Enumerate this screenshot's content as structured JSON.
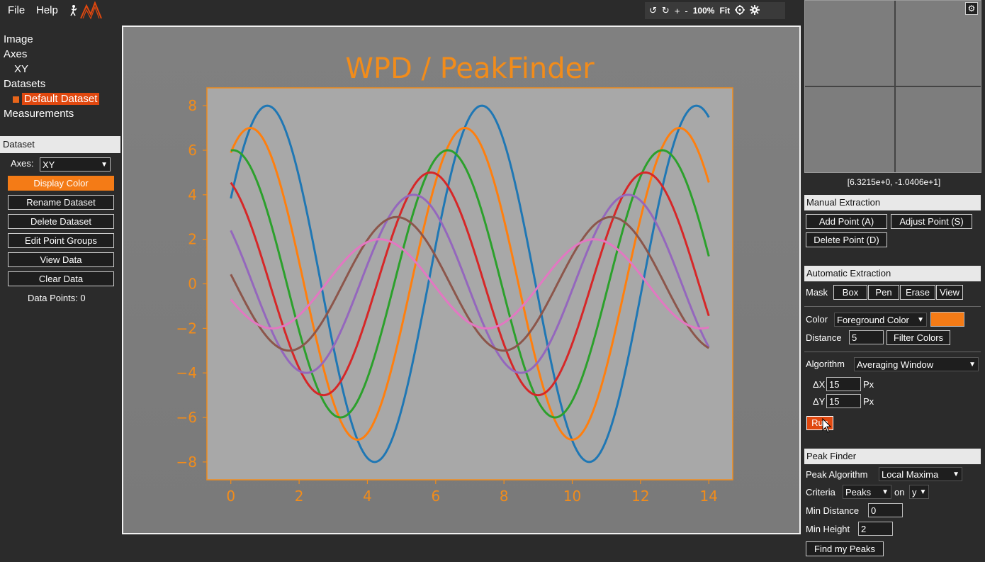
{
  "menu": {
    "file": "File",
    "help": "Help"
  },
  "toolbar": {
    "rotate_ccw": "↺",
    "rotate_cw": "↻",
    "zoom_in": "+",
    "zoom_out": "-",
    "zoom_level": "100%",
    "fit": "Fit"
  },
  "tree": {
    "image": "Image",
    "axes": "Axes",
    "axes_child": "XY",
    "datasets": "Datasets",
    "dataset_child": "Default Dataset",
    "measurements": "Measurements"
  },
  "dataset_panel": {
    "header": "Dataset",
    "axes_label": "Axes:",
    "axes_value": "XY",
    "buttons": [
      "Display Color",
      "Rename Dataset",
      "Delete Dataset",
      "Edit Point Groups",
      "View Data",
      "Clear Data"
    ],
    "data_points": "Data Points: 0"
  },
  "coordinates": "[6.3215e+0, -1.0406e+1]",
  "manual": {
    "header": "Manual Extraction",
    "add_point": "Add Point (A)",
    "adjust_point": "Adjust Point (S)",
    "delete_point": "Delete Point (D)"
  },
  "automatic": {
    "header": "Automatic Extraction",
    "mask_label": "Mask",
    "mask_buttons": [
      "Box",
      "Pen",
      "Erase",
      "View"
    ],
    "color_label": "Color",
    "color_mode": "Foreground Color",
    "color_value": "#f47b16",
    "distance_label": "Distance",
    "distance_value": "5",
    "filter_colors": "Filter Colors",
    "algorithm_label": "Algorithm",
    "algorithm_value": "Averaging Window",
    "dx_label": "ΔX",
    "dx_value": "15",
    "dy_label": "ΔY",
    "dy_value": "15",
    "px_unit": "Px",
    "run": "Run"
  },
  "peak_finder": {
    "header": "Peak Finder",
    "algorithm_label": "Peak Algorithm",
    "algorithm_value": "Local Maxima",
    "criteria_label": "Criteria",
    "criteria_value": "Peaks",
    "on_label": "on",
    "on_value": "y",
    "min_distance_label": "Min Distance",
    "min_distance_value": "0",
    "min_height_label": "Min Height",
    "min_height_value": "2",
    "find_button": "Find my Peaks"
  },
  "chart_data": {
    "type": "line",
    "title": "WPD / PeakFinder",
    "xlabel": "",
    "ylabel": "",
    "xlim": [
      -0.7,
      14.7
    ],
    "ylim": [
      -8.8,
      8.8
    ],
    "xticks": [
      0,
      2,
      4,
      6,
      8,
      10,
      12,
      14
    ],
    "yticks": [
      -8,
      -6,
      -4,
      -2,
      0,
      2,
      4,
      6,
      8
    ],
    "ytick_labels": [
      "−8",
      "−6",
      "−4",
      "−2",
      "0",
      "2",
      "4",
      "6",
      "8"
    ],
    "grid": false,
    "series": [
      {
        "amplitude": 8,
        "phase": 0.5,
        "color": "#1f77b4"
      },
      {
        "amplitude": 7,
        "phase": 1.0,
        "color": "#ff7f0e"
      },
      {
        "amplitude": 6,
        "phase": 1.5,
        "color": "#2ca02c"
      },
      {
        "amplitude": 5,
        "phase": 2.0,
        "color": "#d62728"
      },
      {
        "amplitude": 4,
        "phase": 2.5,
        "color": "#9467bd"
      },
      {
        "amplitude": 3,
        "phase": 3.0,
        "color": "#8c564b"
      },
      {
        "amplitude": 2,
        "phase": 3.5,
        "color": "#e377c2"
      }
    ],
    "x_start": 0,
    "x_end": 14,
    "formula": "y = amplitude * sin(x + phase)"
  }
}
